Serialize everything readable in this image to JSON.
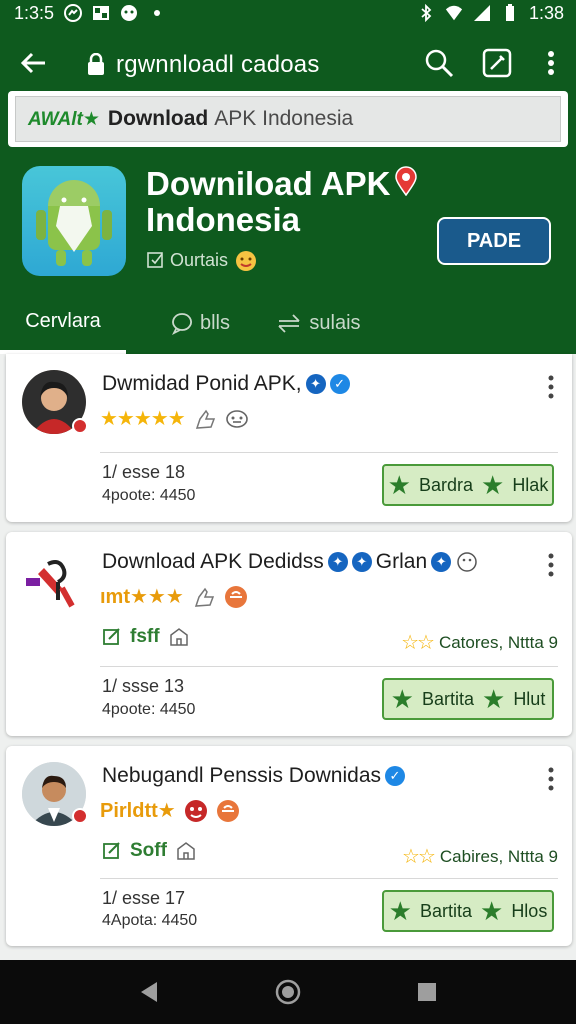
{
  "status": {
    "time_left": "1:3:5",
    "time_right": "1:38"
  },
  "browser": {
    "url": "rgwnnloadl cadoas"
  },
  "search": {
    "logo": "AWAlt★",
    "strong": "Download",
    "rest": "APK Indonesia"
  },
  "app": {
    "title_line1": "Downiload APK",
    "title_line2": "Indonesia",
    "subtitle": "Ourtais",
    "action_label": "PADE"
  },
  "tabs": [
    {
      "label": "Cervlara"
    },
    {
      "label": "blls"
    },
    {
      "label": "sulais"
    }
  ],
  "cards": [
    {
      "title": "Dwmidad Ponid APK,",
      "stars": "★★★★★",
      "meta1": "1/ esse 18",
      "meta2": "4poote: 4450",
      "action_label": "Bardra",
      "action_label2": "Hlak"
    },
    {
      "title": "Download  APK Dedidss",
      "title_suffix": "Grlan",
      "rating_text": "ımt★★★",
      "tag": "fsff",
      "right_info": "Catores, Nttta 9",
      "meta1": "1/  ssse 13",
      "meta2": "4poote: 4450",
      "action_label": "Bartita",
      "action_label2": "Hlut"
    },
    {
      "title": "Nebugandl Penssis Downidas",
      "rating_text": "Pirldtt★",
      "tag": "Soff",
      "right_info": "Cabires, Nttta 9",
      "meta1": "1/  esse 17",
      "meta2": "4Apota: 4450",
      "action_label": "Bartita",
      "action_label2": "Hlos"
    }
  ],
  "colors": {
    "header": "#0e5a1e",
    "accent_blue": "#1a5a8c",
    "star": "#f5b50a",
    "button_green_bg": "#d6ecc4"
  }
}
